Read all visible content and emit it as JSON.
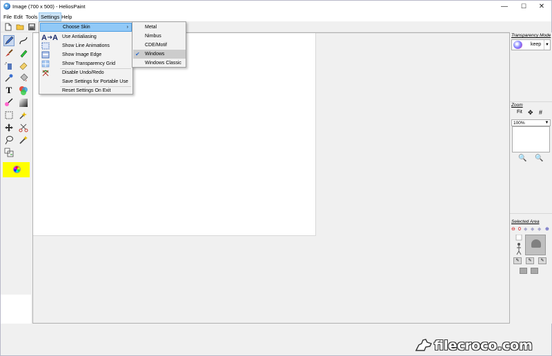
{
  "window": {
    "title": "Image (700 x 500)  - HeliosPaint",
    "minimize": "—",
    "maximize": "☐",
    "close": "✕"
  },
  "menubar": {
    "items": [
      "File",
      "Edit",
      "Tools",
      "Settings",
      "Help"
    ],
    "active": "Settings"
  },
  "settings_menu": {
    "items": [
      {
        "label": "Choose Skin",
        "icon": "none",
        "has_submenu": true,
        "highlighted": true
      },
      {
        "label": "Use Antialiasing",
        "icon": "antialias-icon"
      },
      {
        "label": "Show Line Animations",
        "icon": "dashed-rect-icon"
      },
      {
        "label": "Show Image Edge",
        "icon": "image-edge-icon"
      },
      {
        "label": "Show Transparency Grid",
        "icon": "transparency-grid-icon"
      },
      {
        "label": "Disable Undo/Redo",
        "icon": "undo-disable-icon"
      },
      {
        "label": "Save Settings for Portable Use",
        "icon": "none"
      },
      {
        "label": "Reset Settings On Exit",
        "icon": "none"
      }
    ],
    "submenu_arrow": "›"
  },
  "skin_submenu": {
    "items": [
      "Metal",
      "Nimbus",
      "CDE/Motif",
      "Windows",
      "Windows Classic"
    ],
    "checked": "Windows",
    "check_mark": "✔"
  },
  "right_panel": {
    "transparency_mode_label": "Transparency Mode",
    "transparency_value": "keep",
    "zoom_label": "Zoom",
    "zoom_value": "100%",
    "selected_area_label": "Selected Area",
    "selected_area_value": "0"
  },
  "watermark": {
    "text": "filecroco.com"
  },
  "colors": {
    "menu_highlight": "#91c9f7",
    "selected_color": "#ffff00",
    "canvas": "#ffffff",
    "workspace": "#f0f0f0"
  }
}
